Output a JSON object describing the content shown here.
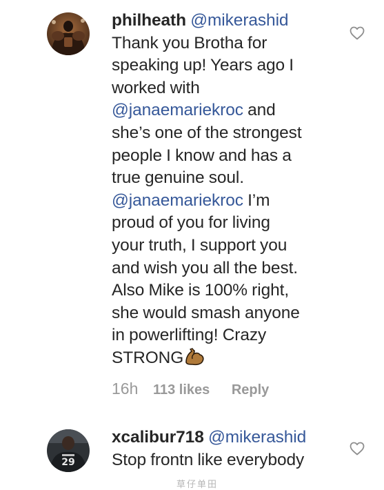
{
  "comments": [
    {
      "username": "philheath",
      "mention": "@mikerashid",
      "lines": [
        [
          "Thank you Brotha for"
        ],
        [
          "speaking up! Years ago I"
        ],
        [
          "worked with"
        ],
        [
          "@janaemariekroc",
          " and"
        ],
        [
          "she’s one of the strongest"
        ],
        [
          "people I know and has a"
        ],
        [
          "true genuine soul."
        ],
        [
          "@janaemariekroc",
          " I’m"
        ],
        [
          "proud of you for living"
        ],
        [
          "your truth, I support you"
        ],
        [
          "and wish you all the best."
        ],
        [
          "Also Mike is 100% right,"
        ],
        [
          "she would smash anyone"
        ],
        [
          "in powerlifting! Crazy"
        ],
        [
          "STRONG"
        ]
      ],
      "emoji": "flexed-biceps-icon",
      "time": "16h",
      "likes": "113 likes",
      "reply": "Reply"
    },
    {
      "username": "xcalibur718",
      "mention": "@mikerashid",
      "line1": "Stop frontn like everybody"
    }
  ],
  "watermark": "草仔单田",
  "colors": {
    "text": "#262626",
    "mention": "#365899",
    "meta": "#999999"
  }
}
